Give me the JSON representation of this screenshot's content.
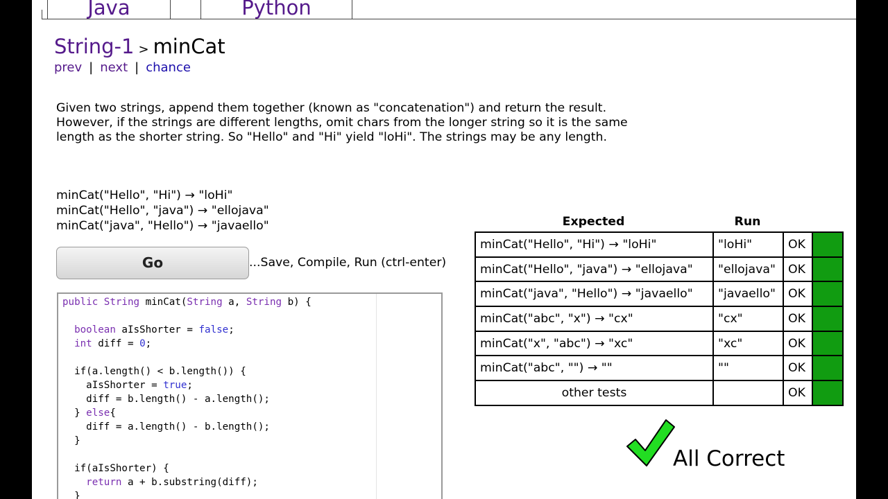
{
  "tabs": [
    {
      "label": "Java"
    },
    {
      "label": "Python"
    }
  ],
  "breadcrumb": {
    "parent": "String-1",
    "separator": ">",
    "current": "minCat"
  },
  "nav": {
    "prev": "prev",
    "next": "next",
    "chance": "chance",
    "separator": "|"
  },
  "description": "Given two strings, append them together (known as \"concatenation\") and return the result. However, if the strings are different lengths, omit chars from the longer string so it is the same length as the shorter string. So \"Hello\" and \"Hi\" yield \"loHi\". The strings may be any length.",
  "examples": [
    "minCat(\"Hello\", \"Hi\") → \"loHi\"",
    "minCat(\"Hello\", \"java\") → \"ellojava\"",
    "minCat(\"java\", \"Hello\") → \"javaello\""
  ],
  "go_button": {
    "label": "Go",
    "hint": "...Save, Compile, Run (ctrl-enter)"
  },
  "editor": {
    "lines": [
      "public String minCat(String a, String b) {",
      "",
      "  boolean aIsShorter = false;",
      "  int diff = 0;",
      "",
      "  if(a.length() < b.length()) {",
      "    aIsShorter = true;",
      "    diff = b.length() - a.length();",
      "  } else{",
      "    diff = a.length() - b.length();",
      "  }",
      "",
      "  if(aIsShorter) {",
      "    return a + b.substring(diff);",
      "  }"
    ]
  },
  "results": {
    "header_expected": "Expected",
    "header_run": "Run",
    "rows": [
      {
        "expected": "minCat(\"Hello\", \"Hi\") → \"loHi\"",
        "run": "\"loHi\"",
        "status": "OK"
      },
      {
        "expected": "minCat(\"Hello\", \"java\") → \"ellojava\"",
        "run": "\"ellojava\"",
        "status": "OK"
      },
      {
        "expected": "minCat(\"java\", \"Hello\") → \"javaello\"",
        "run": "\"javaello\"",
        "status": "OK"
      },
      {
        "expected": "minCat(\"abc\", \"x\") → \"cx\"",
        "run": "\"cx\"",
        "status": "OK"
      },
      {
        "expected": "minCat(\"x\", \"abc\") → \"xc\"",
        "run": "\"xc\"",
        "status": "OK"
      },
      {
        "expected": "minCat(\"abc\", \"\") → \"\"",
        "run": "\"\"",
        "status": "OK"
      },
      {
        "expected": "other tests",
        "run": "",
        "status": "OK"
      }
    ],
    "pass_color": "#119c11"
  },
  "summary": {
    "text": "All Correct",
    "icon": "checkmark-icon",
    "icon_color": "#22dd22"
  },
  "colors": {
    "link_visited": "#551a8b",
    "link": "#1a0dab",
    "frame": "#000000"
  }
}
